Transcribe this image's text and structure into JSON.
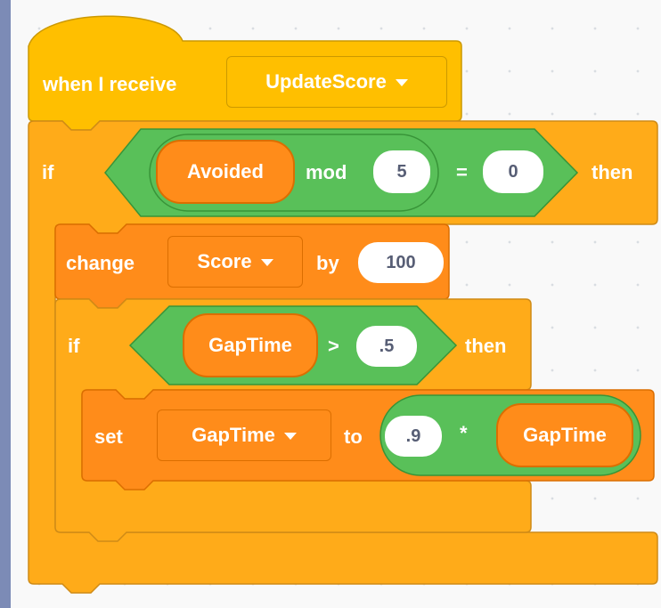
{
  "hat": {
    "label": "when I receive",
    "message": "UpdateScore"
  },
  "if_outer": {
    "if_label": "if",
    "then_label": "then",
    "condition": {
      "mod_left": "Avoided",
      "mod_label": "mod",
      "mod_right": "5",
      "equals": "=",
      "compare_right": "0"
    }
  },
  "change_block": {
    "label": "change",
    "variable": "Score",
    "by_label": "by",
    "value": "100"
  },
  "if_inner": {
    "if_label": "if",
    "then_label": "then",
    "condition": {
      "left": "GapTime",
      "op": ">",
      "right": ".5"
    }
  },
  "set_block": {
    "label": "set",
    "variable": "GapTime",
    "to_label": "to",
    "expr": {
      "left": ".9",
      "op": "*",
      "right": "GapTime"
    }
  },
  "colors": {
    "events": "#ffbf00",
    "control": "#ffab19",
    "variables": "#ff8c1a",
    "operators": "#59c059"
  }
}
